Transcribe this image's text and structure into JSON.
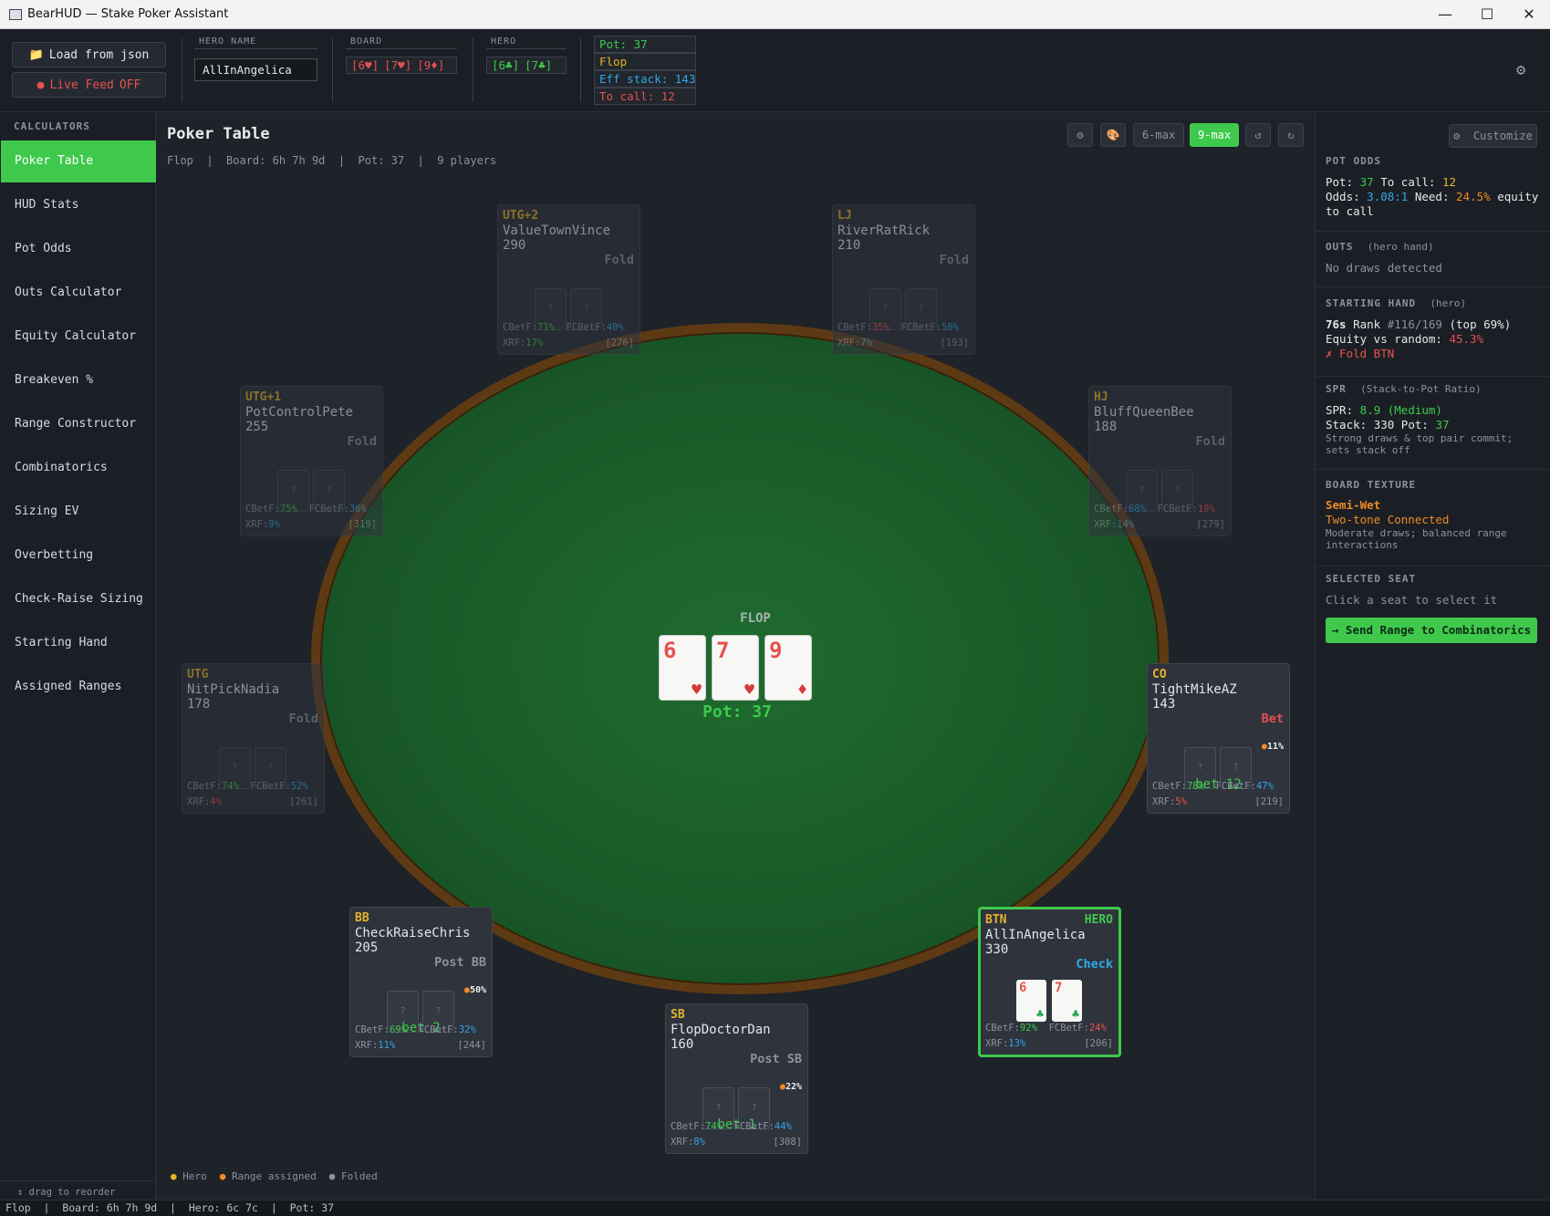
{
  "window": {
    "title": "BearHUD — Stake Poker Assistant",
    "min": "—",
    "max": "☐",
    "close": "✕"
  },
  "toolbar": {
    "load_label": "Load from json",
    "live_label": "Live Feed",
    "live_state": "OFF",
    "hero_name_label": "HERO NAME",
    "hero_name_value": "AllInAngelica",
    "board_label": "BOARD",
    "board_cards": [
      "[6♥]",
      "[7♥]",
      "[9♦]"
    ],
    "hero_label": "HERO",
    "hero_cards": [
      "[6♣]",
      "[7♣]"
    ],
    "info": {
      "pot": "Pot: 37",
      "street": "Flop",
      "eff": "Eff stack: 143",
      "tocall": "To call: 12"
    }
  },
  "sidebar": {
    "header": "CALCULATORS",
    "items": [
      "Poker Table",
      "HUD Stats",
      "Pot Odds",
      "Outs Calculator",
      "Equity Calculator",
      "Breakeven %",
      "Range Constructor",
      "Combinatorics",
      "Sizing EV",
      "Overbetting",
      "Check-Raise Sizing",
      "Starting Hand",
      "Assigned Ranges"
    ],
    "active": "Poker Table",
    "drag_note": "↕ drag to reorder"
  },
  "main": {
    "title": "Poker Table",
    "subtitle": {
      "street": "Flop",
      "board": "Board: 6h 7h 9d",
      "pot": "Pot: 37",
      "players": "9 players"
    },
    "controls": {
      "six": "6-max",
      "nine": "9-max"
    },
    "table": {
      "street": "FLOP",
      "pot": "Pot: 37",
      "board": [
        {
          "rank": "6",
          "suit": "♥"
        },
        {
          "rank": "7",
          "suit": "♥"
        },
        {
          "rank": "9",
          "suit": "♦"
        }
      ]
    },
    "legend": {
      "hero": "Hero",
      "range": "Range assigned",
      "folded": "Folded"
    }
  },
  "seats": [
    {
      "pos": "UTG+2",
      "name": "ValueTownVince",
      "stack": "290",
      "action": "Fold",
      "cbet": "71%",
      "fcbet": "40%",
      "xrf": "17%",
      "hands": "[276]"
    },
    {
      "pos": "LJ",
      "name": "RiverRatRick",
      "stack": "210",
      "action": "Fold",
      "cbet": "35%",
      "fcbet": "58%",
      "xrf": "7%",
      "hands": "[193]"
    },
    {
      "pos": "UTG+1",
      "name": "PotControlPete",
      "stack": "255",
      "action": "Fold",
      "cbet": "75%",
      "fcbet": "36%",
      "xrf": "9%",
      "hands": "[319]"
    },
    {
      "pos": "HJ",
      "name": "BluffQueenBee",
      "stack": "188",
      "action": "Fold",
      "cbet": "68%",
      "fcbet": "19%",
      "xrf": "14%",
      "hands": "[279]"
    },
    {
      "pos": "UTG",
      "name": "NitPickNadia",
      "stack": "178",
      "action": "Fold",
      "cbet": "74%",
      "fcbet": "52%",
      "xrf": "4%",
      "hands": "[261]"
    },
    {
      "pos": "CO",
      "name": "TightMikeAZ",
      "stack": "143",
      "action": "Bet",
      "bet": "bet 12",
      "range_pct": "11%",
      "cbet": "78%",
      "fcbet": "47%",
      "xrf": "5%",
      "hands": "[219]"
    },
    {
      "pos": "BB",
      "name": "CheckRaiseChris",
      "stack": "205",
      "action": "Post BB",
      "bet": "bet 2",
      "range_pct": "50%",
      "cbet": "69%",
      "fcbet": "32%",
      "xrf": "11%",
      "hands": "[244]"
    },
    {
      "pos": "SB",
      "name": "FlopDoctorDan",
      "stack": "160",
      "action": "Post SB",
      "bet": "bet 1",
      "range_pct": "22%",
      "cbet": "74%",
      "fcbet": "44%",
      "xrf": "8%",
      "hands": "[308]"
    },
    {
      "pos": "BTN",
      "hero_tag": "HERO",
      "name": "AllInAngelica",
      "stack": "330",
      "action": "Check",
      "cards": [
        {
          "rank": "6",
          "suit": "♣"
        },
        {
          "rank": "7",
          "suit": "♣"
        }
      ],
      "cbet": "92%",
      "fcbet": "24%",
      "xrf": "13%",
      "hands": "[206]"
    }
  ],
  "stat_labels": {
    "cbet": "CBetF:",
    "fcbet": "FCBetF:",
    "xrf": "XRF:",
    "hidden": "?"
  },
  "panel": {
    "customize": "Customize",
    "pot_odds": {
      "head": "POT ODDS",
      "pot_label": "Pot:",
      "pot": "37",
      "call_label": "To call:",
      "call": "12",
      "odds_label": "Odds:",
      "odds": "3.08:1",
      "need_label": "Need:",
      "need": "24.5%",
      "tail": "equity to call"
    },
    "outs": {
      "head": "OUTS",
      "sub": "(hero hand)",
      "text": "No draws detected"
    },
    "starting": {
      "head": "STARTING HAND",
      "sub": "(hero)",
      "hand": "76s",
      "rank_label": "Rank",
      "rank": "#116/169",
      "top": "(top 69%)",
      "eq_label": "Equity vs random:",
      "eq": "45.3%",
      "verdict": "✗ Fold BTN"
    },
    "spr": {
      "head": "SPR",
      "sub": "(Stack-to-Pot Ratio)",
      "spr_label": "SPR:",
      "spr": "8.9 (Medium)",
      "stack_label": "Stack:",
      "stack": "330",
      "pot_label": "Pot:",
      "pot": "37",
      "note": "Strong draws & top pair commit; sets stack off"
    },
    "texture": {
      "head": "BOARD TEXTURE",
      "l1": "Semi-Wet",
      "l2": "Two-tone Connected",
      "note": "Moderate draws; balanced range interactions"
    },
    "selected": {
      "head": "SELECTED SEAT",
      "text": "Click a seat to select it"
    },
    "send": "→ Send Range to Combinatorics"
  },
  "status": {
    "street": "Flop",
    "board": "Board: 6h 7h 9d",
    "hero": "Hero: 6c 7c",
    "pot": "Pot: 37"
  },
  "colors": {
    "accent": "#3ec94c",
    "position": "#e6b22d",
    "felt": "#1a5a28",
    "rail": "#5e3a14",
    "bet_red": "#e6524e",
    "blue": "#2fa8e8"
  }
}
